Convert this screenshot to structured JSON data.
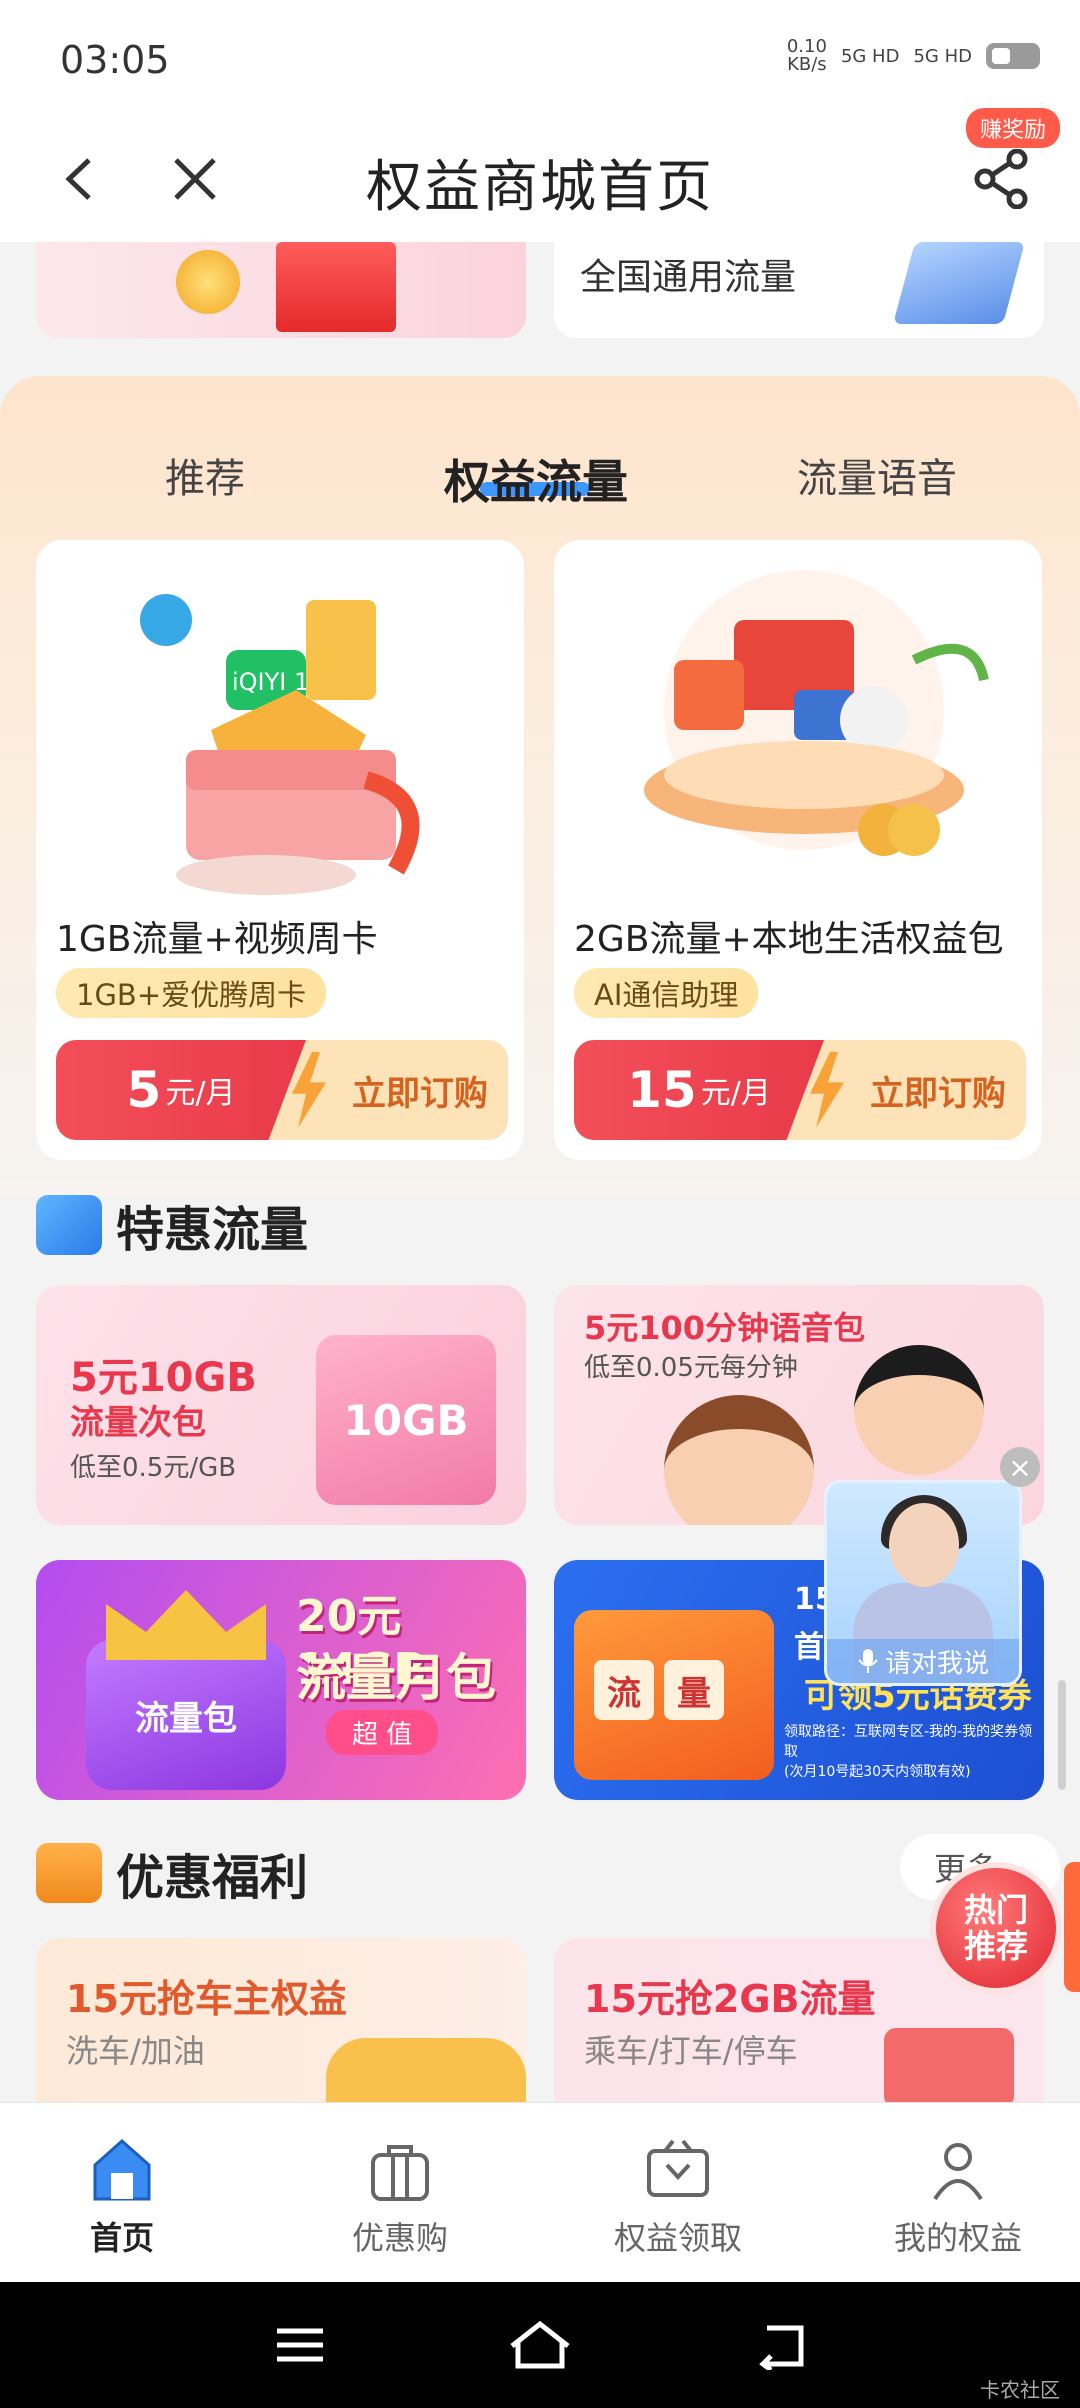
{
  "status": {
    "time": "03:05",
    "net_speed": "0.10",
    "net_unit": "KB/s",
    "sig1": "5G HD",
    "sig2": "5G HD"
  },
  "header": {
    "title": "权益商城首页",
    "reward_badge": "赚奖励"
  },
  "top_partial": {
    "right_text": "全国通用流量"
  },
  "tabs": [
    {
      "label": "推荐"
    },
    {
      "label": "权益流量"
    },
    {
      "label": "流量语音"
    }
  ],
  "products": [
    {
      "title": "1GB流量+视频周卡",
      "tag": "1GB+爱优腾周卡",
      "price": "5",
      "unit": "元/月",
      "button": "立即订购",
      "img_text": "iQIYI 1GB"
    },
    {
      "title": "2GB流量+本地生活权益包",
      "tag": "AI通信助理",
      "price": "15",
      "unit": "元/月",
      "button": "立即订购"
    }
  ],
  "sections": {
    "special": "特惠流量",
    "welfare": "优惠福利"
  },
  "banners": {
    "b1": {
      "line1": "5元10GB",
      "line2": "流量次包",
      "line3": "低至0.5元/GB",
      "box": "10GB"
    },
    "b2": {
      "line1": "5元100分钟语音包",
      "line2": "低至0.05元每分钟"
    },
    "b3": {
      "line1": "20元14GB",
      "line2": "流量月包",
      "line3": "超 值",
      "box": "流量包"
    },
    "b4": {
      "line1": "15",
      "line2": "首次",
      "line3": "可领5元话费券",
      "line4": "领取路径：互联网专区-我的-我的奖券领取",
      "line5": "(次月10号起30天内领取有效)",
      "box1": "流",
      "box2": "量"
    }
  },
  "assistant": {
    "prompt": "请对我说",
    "close": "×"
  },
  "more_button": "更多",
  "hot": {
    "line1": "热门",
    "line2": "推荐"
  },
  "welfare": [
    {
      "title": "15元抢车主权益",
      "sub": "洗车/加油"
    },
    {
      "title": "15元抢2GB流量",
      "sub": "乘车/打车/停车"
    }
  ],
  "nav": [
    {
      "label": "首页"
    },
    {
      "label": "优惠购"
    },
    {
      "label": "权益领取"
    },
    {
      "label": "我的权益"
    }
  ],
  "watermark": "卡农社区",
  "colors": {
    "accent": "#3e96ff",
    "price_red": "#e93a4a",
    "orange": "#d5621e"
  }
}
